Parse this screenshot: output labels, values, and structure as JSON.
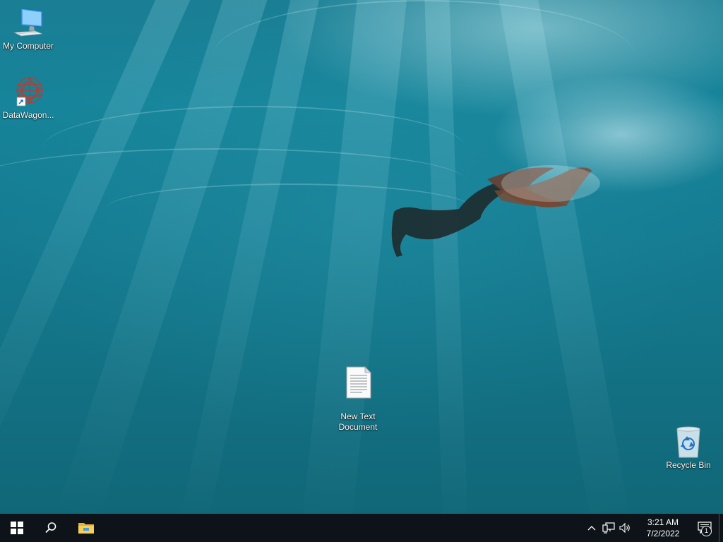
{
  "desktop": {
    "icons": [
      {
        "name": "my-computer",
        "label": "My Computer",
        "icon": "monitor-icon"
      },
      {
        "name": "datawagon",
        "label": "DataWagon...",
        "icon": "datawagon-shortcut-icon"
      },
      {
        "name": "new-text-document",
        "label": "New Text\nDocument",
        "icon": "text-document-icon"
      },
      {
        "name": "recycle-bin",
        "label": "Recycle Bin",
        "icon": "recycle-bin-icon"
      }
    ]
  },
  "taskbar": {
    "start_icon": "windows-logo-icon",
    "search_icon": "search-icon",
    "pinned": [
      {
        "name": "file-explorer",
        "icon": "folder-icon"
      }
    ],
    "tray": {
      "icons": [
        "chevron-up-icon",
        "network-icon",
        "speaker-icon"
      ],
      "time": "3:21 AM",
      "date": "7/2/2022",
      "notification_count": "1"
    }
  },
  "colors": {
    "taskbar_bg": "#0d1318",
    "water": "#157c92",
    "datawagon_red": "#c0392b"
  }
}
